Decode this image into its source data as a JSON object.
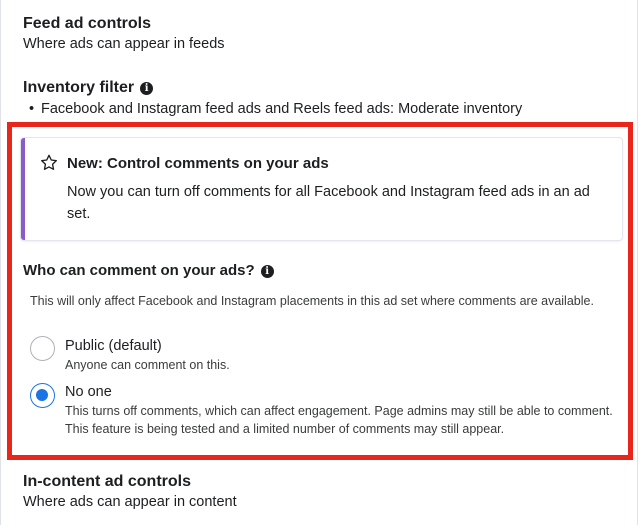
{
  "feed_controls": {
    "title": "Feed ad controls",
    "subtitle": "Where ads can appear in feeds"
  },
  "inventory_filter": {
    "title": "Inventory filter",
    "info_icon": "info-icon",
    "bullet": "•",
    "item": "Facebook and Instagram feed ads and Reels feed ads: Moderate inventory"
  },
  "callout": {
    "icon": "star-icon",
    "accent_color": "#8b5cc7",
    "title": "New: Control comments on your ads",
    "body": "Now you can turn off comments for all Facebook and Instagram feed ads in an ad set."
  },
  "comments": {
    "title": "Who can comment on your ads?",
    "info_icon": "info-icon",
    "note": "This will only affect Facebook and Instagram placements in this ad set where comments are available.",
    "options": [
      {
        "label": "Public (default)",
        "description": "Anyone can comment on this.",
        "selected": false
      },
      {
        "label": "No one",
        "description": "This turns off comments, which can affect engagement. Page admins may still be able to comment. This feature is being tested and a limited number of comments may still appear.",
        "selected": true
      }
    ]
  },
  "in_content_controls": {
    "title": "In-content ad controls",
    "subtitle": "Where ads can appear in content"
  },
  "colors": {
    "highlight_border": "#e8261c",
    "radio_selected": "#1b74e4",
    "text": "#1c1e21"
  }
}
